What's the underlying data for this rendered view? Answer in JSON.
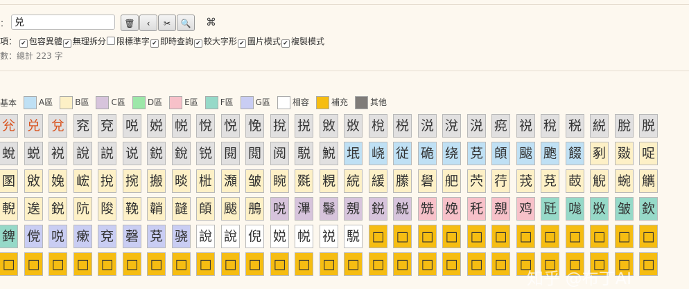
{
  "search": {
    "label_fragment": "：",
    "value": "兑",
    "buttons": [
      "🗑",
      "‹",
      "✂",
      "🔍"
    ],
    "extra_symbol": "⌘"
  },
  "options": {
    "label_fragment": "項：",
    "items": [
      {
        "label": "包容異體",
        "checked": true
      },
      {
        "label": "無理拆分",
        "checked": true
      },
      {
        "label": "限標準字",
        "checked": false
      },
      {
        "label": "即時查詢",
        "checked": true
      },
      {
        "label": "較大字形",
        "checked": true
      },
      {
        "label": "圖片模式",
        "checked": true
      },
      {
        "label": "複製模式",
        "checked": true
      }
    ]
  },
  "count": {
    "label_fragment": "數：",
    "text": "總計 223 字"
  },
  "legend": [
    {
      "label": "基本",
      "color": null
    },
    {
      "label": "A區",
      "color": "#bfe0f4"
    },
    {
      "label": "B區",
      "color": "#fdf0c6"
    },
    {
      "label": "C區",
      "color": "#d7c4dc"
    },
    {
      "label": "D區",
      "color": "#9de7a9"
    },
    {
      "label": "E區",
      "color": "#f7c1c9"
    },
    {
      "label": "F區",
      "color": "#96d9c8"
    },
    {
      "label": "G區",
      "color": "#c9cdf3"
    },
    {
      "label": "相容",
      "color": "#ffffff"
    },
    {
      "label": "補充",
      "color": "#f6bd12"
    },
    {
      "label": "其他",
      "color": "#7f7c79"
    }
  ],
  "colors": {
    "basic": "#e1e0e0",
    "A": "#bfe0f4",
    "B": "#fdf0c6",
    "C": "#d7c4dc",
    "D": "#9de7a9",
    "E": "#f7c1c9",
    "F": "#96d9c8",
    "G": "#c9cdf3",
    "compat": "#ffffff",
    "supp": "#f6bd12",
    "highlight_text": "#d9531e"
  },
  "rows": [
    [
      [
        "兊",
        "basic",
        1
      ],
      [
        "兑",
        "basic",
        1
      ],
      [
        "兌",
        "basic",
        1
      ],
      [
        "兖",
        "basic",
        0
      ],
      [
        "兗",
        "basic",
        0
      ],
      [
        "哾",
        "basic",
        0
      ],
      [
        "娧",
        "basic",
        0
      ],
      [
        "帨",
        "basic",
        0
      ],
      [
        "悅",
        "basic",
        0
      ],
      [
        "悦",
        "basic",
        0
      ],
      [
        "悗",
        "basic",
        0
      ],
      [
        "挩",
        "basic",
        0
      ],
      [
        "捝",
        "basic",
        0
      ],
      [
        "敓",
        "basic",
        0
      ],
      [
        "敚",
        "basic",
        0
      ],
      [
        "梲",
        "basic",
        0
      ],
      [
        "棁",
        "basic",
        0
      ],
      [
        "涚",
        "basic",
        0
      ],
      [
        "涗",
        "basic",
        0
      ],
      [
        "涚",
        "basic",
        0
      ],
      [
        "痥",
        "basic",
        0
      ],
      [
        "祱",
        "basic",
        0
      ],
      [
        "稅",
        "basic",
        0
      ],
      [
        "税",
        "basic",
        0
      ],
      [
        "綐",
        "basic",
        0
      ],
      [
        "脫",
        "basic",
        0
      ],
      [
        "脱",
        "basic",
        0
      ]
    ],
    [
      [
        "蛻",
        "basic",
        0
      ],
      [
        "蜕",
        "basic",
        0
      ],
      [
        "裞",
        "basic",
        0
      ],
      [
        "說",
        "basic",
        0
      ],
      [
        "説",
        "basic",
        0
      ],
      [
        "说",
        "basic",
        0
      ],
      [
        "鋭",
        "basic",
        0
      ],
      [
        "銳",
        "basic",
        0
      ],
      [
        "锐",
        "basic",
        0
      ],
      [
        "閱",
        "basic",
        0
      ],
      [
        "閲",
        "basic",
        0
      ],
      [
        "阅",
        "basic",
        0
      ],
      [
        "駾",
        "basic",
        0
      ],
      [
        "鮵",
        "basic",
        0
      ],
      [
        "垊",
        "A",
        0
      ],
      [
        "峣",
        "A",
        0
      ],
      [
        "従",
        "A",
        0
      ],
      [
        "硊",
        "A",
        0
      ],
      [
        "绕",
        "A",
        0
      ],
      [
        "莌",
        "A",
        0
      ],
      [
        "頧",
        "A",
        0
      ],
      [
        "颰",
        "A",
        0
      ],
      [
        "颮",
        "A",
        0
      ],
      [
        "餟",
        "A",
        0
      ],
      [
        "剢",
        "B",
        0
      ],
      [
        "敠",
        "B",
        0
      ],
      [
        "哫",
        "B",
        0
      ]
    ],
    [
      [
        "圂",
        "B",
        0
      ],
      [
        "敓",
        "B",
        0
      ],
      [
        "婏",
        "B",
        0
      ],
      [
        "峵",
        "B",
        0
      ],
      [
        "挩",
        "B",
        0
      ],
      [
        "捥",
        "B",
        0
      ],
      [
        "搬",
        "B",
        0
      ],
      [
        "晱",
        "B",
        0
      ],
      [
        "梉",
        "B",
        0
      ],
      [
        "瀩",
        "B",
        0
      ],
      [
        "皱",
        "B",
        0
      ],
      [
        "睕",
        "B",
        0
      ],
      [
        "毲",
        "B",
        0
      ],
      [
        "粯",
        "B",
        0
      ],
      [
        "綂",
        "B",
        0
      ],
      [
        "緩",
        "B",
        0
      ],
      [
        "縢",
        "B",
        0
      ],
      [
        "礐",
        "B",
        0
      ],
      [
        "舥",
        "B",
        0
      ],
      [
        "茓",
        "B",
        0
      ],
      [
        "荇",
        "B",
        0
      ],
      [
        "茙",
        "B",
        0
      ],
      [
        "莌",
        "B",
        0
      ],
      [
        "菣",
        "B",
        0
      ],
      [
        "觬",
        "B",
        0
      ],
      [
        "蜿",
        "B",
        0
      ],
      [
        "觽",
        "B",
        0
      ]
    ],
    [
      [
        "輗",
        "B",
        0
      ],
      [
        "逘",
        "B",
        0
      ],
      [
        "鋭",
        "B",
        0
      ],
      [
        "阬",
        "B",
        0
      ],
      [
        "陖",
        "B",
        0
      ],
      [
        "鞔",
        "B",
        0
      ],
      [
        "韒",
        "B",
        0
      ],
      [
        "韼",
        "B",
        0
      ],
      [
        "頧",
        "B",
        0
      ],
      [
        "颰",
        "B",
        0
      ],
      [
        "鴅",
        "B",
        0
      ],
      [
        "哾",
        "C",
        0
      ],
      [
        "滭",
        "C",
        0
      ],
      [
        "鬈",
        "C",
        0
      ],
      [
        "覫",
        "C",
        0
      ],
      [
        "鋭",
        "C",
        0
      ],
      [
        "鮵",
        "C",
        0
      ],
      [
        "兟",
        "E",
        0
      ],
      [
        "娩",
        "E",
        0
      ],
      [
        "秅",
        "E",
        0
      ],
      [
        "覫",
        "E",
        0
      ],
      [
        "鸡",
        "E",
        0
      ],
      [
        "瓩",
        "F",
        0
      ],
      [
        "哤",
        "F",
        0
      ],
      [
        "敚",
        "F",
        0
      ],
      [
        "皱",
        "F",
        0
      ],
      [
        "欽",
        "F",
        0
      ]
    ],
    [
      [
        "錍",
        "F",
        0
      ],
      [
        "傥",
        "G",
        0
      ],
      [
        "哾",
        "G",
        0
      ],
      [
        "瘶",
        "G",
        0
      ],
      [
        "兗",
        "G",
        0
      ],
      [
        "磬",
        "G",
        0
      ],
      [
        "莌",
        "G",
        0
      ],
      [
        "骁",
        "G",
        0
      ],
      [
        "說",
        "compat",
        0
      ],
      [
        "說",
        "compat",
        0
      ],
      [
        "倪",
        "compat",
        0
      ],
      [
        "娧",
        "compat",
        0
      ],
      [
        "帨",
        "compat",
        0
      ],
      [
        "祱",
        "compat",
        0
      ],
      [
        "駾",
        "compat",
        0
      ],
      [
        "□",
        "supp",
        0
      ],
      [
        "□",
        "supp",
        0
      ],
      [
        "□",
        "supp",
        0
      ],
      [
        "□",
        "supp",
        0
      ],
      [
        "□",
        "supp",
        0
      ],
      [
        "□",
        "supp",
        0
      ],
      [
        "□",
        "supp",
        0
      ],
      [
        "□",
        "supp",
        0
      ],
      [
        "□",
        "supp",
        0
      ],
      [
        "□",
        "supp",
        0
      ],
      [
        "□",
        "supp",
        0
      ],
      [
        "□",
        "supp",
        0
      ]
    ],
    [
      [
        "□",
        "supp",
        0
      ],
      [
        "□",
        "supp",
        0
      ],
      [
        "□",
        "supp",
        0
      ],
      [
        "□",
        "supp",
        0
      ],
      [
        "□",
        "supp",
        0
      ],
      [
        "□",
        "supp",
        0
      ],
      [
        "□",
        "supp",
        0
      ],
      [
        "□",
        "supp",
        0
      ],
      [
        "□",
        "supp",
        0
      ],
      [
        "□",
        "supp",
        0
      ],
      [
        "□",
        "supp",
        0
      ],
      [
        "□",
        "supp",
        0
      ],
      [
        "□",
        "supp",
        0
      ],
      [
        "□",
        "supp",
        0
      ],
      [
        "□",
        "supp",
        0
      ],
      [
        "□",
        "supp",
        0
      ],
      [
        "□",
        "supp",
        0
      ],
      [
        "□",
        "supp",
        0
      ],
      [
        "□",
        "supp",
        0
      ],
      [
        "□",
        "supp",
        0
      ],
      [
        "□",
        "supp",
        0
      ],
      [
        "□",
        "supp",
        0
      ],
      [
        "□",
        "supp",
        0
      ],
      [
        "□",
        "supp",
        0
      ],
      [
        "□",
        "supp",
        0
      ],
      [
        "□",
        "supp",
        0
      ],
      [
        "□",
        "supp",
        0
      ]
    ]
  ],
  "watermark": "知乎 @布丁AI"
}
